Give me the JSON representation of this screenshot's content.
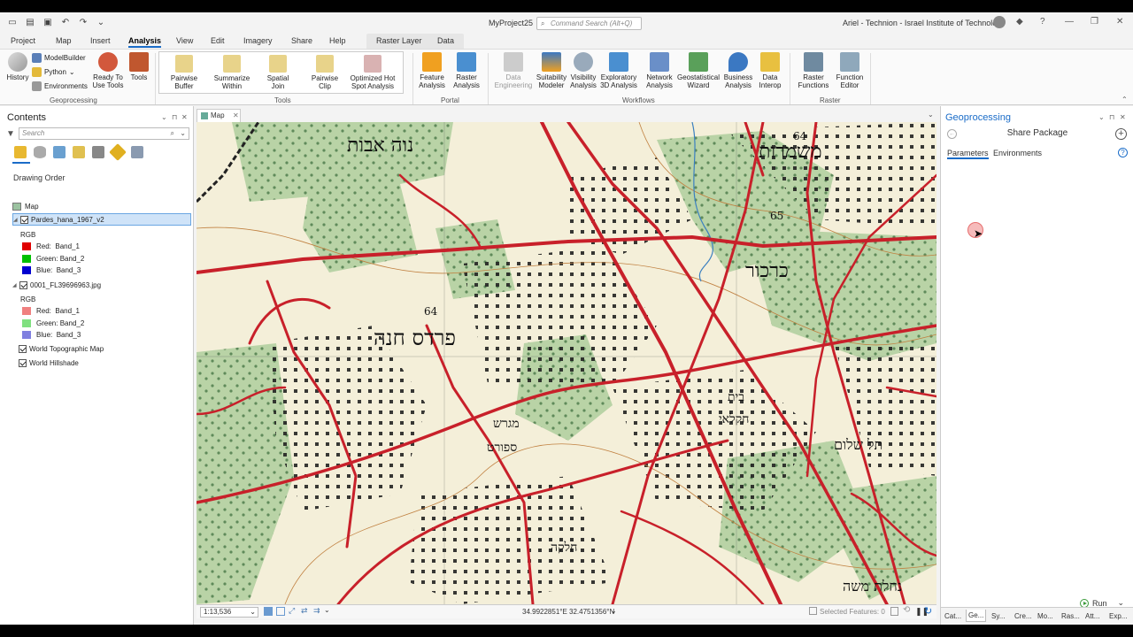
{
  "app": {
    "project_name": "MyProject25",
    "command_search_placeholder": "Command Search (Alt+Q)",
    "user": "Ariel - Technion - Israel Institute of Technology"
  },
  "ribbon_tabs": [
    "Project",
    "Map",
    "Insert",
    "Analysis",
    "View",
    "Edit",
    "Imagery",
    "Share",
    "Help"
  ],
  "active_tab": "Analysis",
  "context_tabs": [
    "Raster Layer",
    "Data"
  ],
  "ribbon": {
    "geoprocessing": {
      "label": "Geoprocessing",
      "history": "History",
      "modelbuilder": "ModelBuilder",
      "python": "Python",
      "environments": "Environments",
      "ready_to_use_tools": [
        "Ready To",
        "Use Tools"
      ],
      "tools": "Tools"
    },
    "tools_group": {
      "label": "Tools",
      "items": [
        [
          "Pairwise",
          "Buffer"
        ],
        [
          "Summarize",
          "Within"
        ],
        [
          "Spatial",
          "Join"
        ],
        [
          "Pairwise",
          "Clip"
        ],
        [
          "Optimized Hot",
          "Spot Analysis"
        ]
      ]
    },
    "portal": {
      "label": "Portal",
      "items": [
        [
          "Feature",
          "Analysis"
        ],
        [
          "Raster",
          "Analysis"
        ]
      ]
    },
    "workflows": {
      "label": "Workflows",
      "items": [
        [
          "Data",
          "Engineering"
        ],
        [
          "Suitability",
          "Modeler"
        ],
        [
          "Visibility",
          "Analysis"
        ],
        [
          "Exploratory",
          "3D Analysis"
        ],
        [
          "Network",
          "Analysis"
        ],
        [
          "Geostatistical",
          "Wizard"
        ],
        [
          "Business",
          "Analysis"
        ],
        [
          "Data",
          "Interop"
        ]
      ]
    },
    "raster": {
      "label": "Raster",
      "items": [
        [
          "Raster",
          "Functions"
        ],
        [
          "Function",
          "Editor"
        ]
      ]
    }
  },
  "contents": {
    "title": "Contents",
    "search_placeholder": "Search",
    "drawing_order": "Drawing Order",
    "map_name": "Map",
    "layers": [
      {
        "name": "Pardes_hana_1967_v2",
        "selected": true,
        "type": "RGB",
        "bands": [
          {
            "label": "Red:",
            "band": "Band_1",
            "color": "#e00000"
          },
          {
            "label": "Green:",
            "band": "Band_2",
            "color": "#00c000"
          },
          {
            "label": "Blue:",
            "band": "Band_3",
            "color": "#0000d0"
          }
        ]
      },
      {
        "name": "0001_FL39696963.jpg",
        "selected": false,
        "type": "RGB",
        "bands": [
          {
            "label": "Red:",
            "band": "Band_1",
            "color": "#f08080"
          },
          {
            "label": "Green:",
            "band": "Band_2",
            "color": "#80e080"
          },
          {
            "label": "Blue:",
            "band": "Band_3",
            "color": "#8080e0"
          }
        ]
      }
    ],
    "basemaps": [
      "World Topographic Map",
      "World Hillshade"
    ]
  },
  "map_view": {
    "tab_label": "Map",
    "scale": "1:13,536",
    "coordinates": "34.9922851°E 32.4751356°N",
    "selected_features": "Selected Features: 0",
    "labels": {
      "neve_avot": "נוה אבות",
      "mishmarot": "משמרות",
      "karkur": "כרכור",
      "pardes_hana": "פרדס חנה",
      "migrash": "מגרש",
      "sport": "ספורט",
      "beit": "בית",
      "kvar": "חקלאי",
      "tel_shalom": "תל שלום",
      "helek": "חלקה",
      "nahal_moshe": "נחלת משה",
      "h65": "65",
      "h64a": "64",
      "h64b": "64"
    }
  },
  "geoprocessing": {
    "title": "Geoprocessing",
    "tool_name": "Share Package",
    "tabs": [
      "Parameters",
      "Environments"
    ],
    "run_label": "Run",
    "bottom_tabs": [
      "Cat...",
      "Ge...",
      "Sy...",
      "Cre...",
      "Mo...",
      "Ras...",
      "Att...",
      "Exp..."
    ]
  },
  "colors": {
    "accent": "#1a6cc8",
    "road": "#c8202a",
    "vegetation": "#b9d3a6",
    "paper": "#f4efd9"
  }
}
